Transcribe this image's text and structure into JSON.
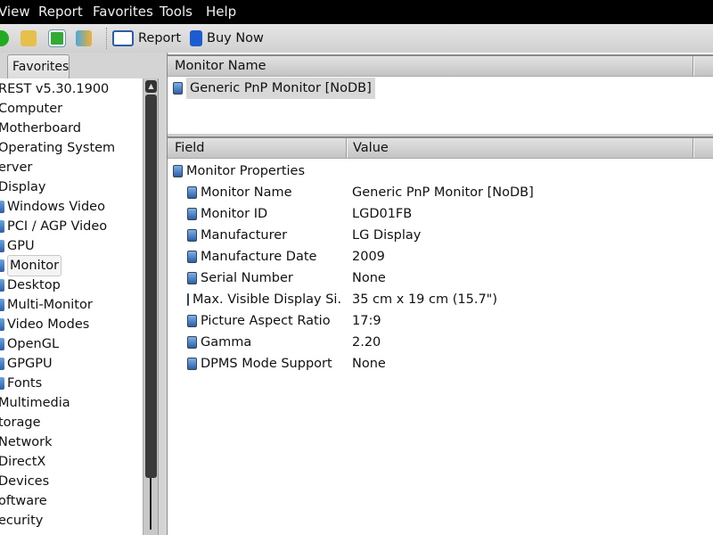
{
  "menu": [
    "View",
    "Report",
    "Favorites",
    "Tools",
    "Help"
  ],
  "toolbar": {
    "report": "Report",
    "buy_now": "Buy Now"
  },
  "tab": "Favorites",
  "tree": [
    "REST v5.30.1900",
    "Computer",
    "Motherboard",
    "Operating System",
    "erver",
    "Display",
    "Windows Video",
    "PCI / AGP Video",
    "GPU",
    "Monitor",
    "Desktop",
    "Multi-Monitor",
    "Video Modes",
    "OpenGL",
    "GPGPU",
    "Fonts",
    "Multimedia",
    "torage",
    "Network",
    "DirectX",
    "Devices",
    "oftware",
    "ecurity"
  ],
  "top_list": {
    "header": "Monitor Name",
    "item": "Generic PnP Monitor [NoDB]"
  },
  "details": {
    "headers": {
      "field": "Field",
      "value": "Value"
    },
    "group": "Monitor Properties",
    "rows": [
      {
        "field": "Monitor Name",
        "value": "Generic PnP Monitor [NoDB]"
      },
      {
        "field": "Monitor ID",
        "value": "LGD01FB"
      },
      {
        "field": "Manufacturer",
        "value": "LG Display"
      },
      {
        "field": "Manufacture Date",
        "value": "2009"
      },
      {
        "field": "Serial Number",
        "value": "None"
      },
      {
        "field": "Max. Visible Display Si...",
        "value": "35 cm x 19 cm (15.7\")"
      },
      {
        "field": "Picture Aspect Ratio",
        "value": "17:9"
      },
      {
        "field": "Gamma",
        "value": "2.20"
      },
      {
        "field": "DPMS Mode Support",
        "value": "None"
      }
    ]
  }
}
